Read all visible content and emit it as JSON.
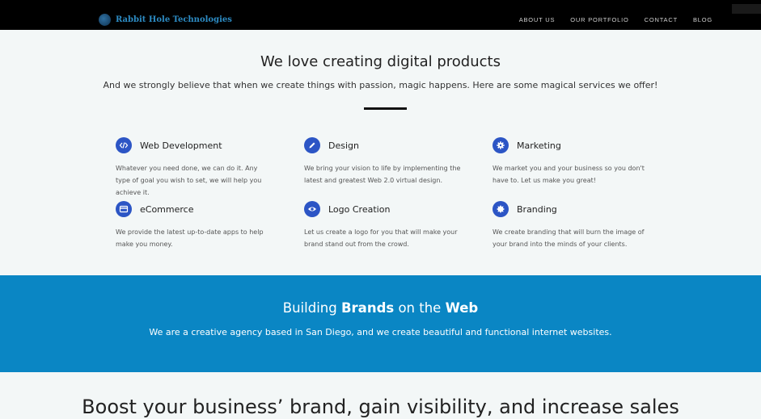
{
  "header": {
    "brand": "Rabbit Hole Technologies",
    "nav": [
      "ABOUT US",
      "OUR PORTFOLIO",
      "CONTACT",
      "BLOG"
    ]
  },
  "intro": {
    "title": "We love creating digital products",
    "subtitle": "And we strongly believe that when we create things with passion, magic happens. Here are some magical services we offer!"
  },
  "services": [
    {
      "title": "Web Development",
      "icon": "code-icon",
      "desc": "Whatever you need done, we can do it. Any type of goal you wish to set, we will help you achieve it."
    },
    {
      "title": "Design",
      "icon": "pencil-icon",
      "desc": "We bring your vision to life by implementing the latest and greatest Web 2.0 virtual design."
    },
    {
      "title": "Marketing",
      "icon": "gear-icon",
      "desc": "We market you and your business so you don't have to. Let us make you great!"
    },
    {
      "title": "eCommerce",
      "icon": "credit-card-icon",
      "desc": "We provide the latest up-to-date apps to help make you money."
    },
    {
      "title": "Logo Creation",
      "icon": "eye-icon",
      "desc": "Let us create a logo for you that will make your brand stand out from the crowd."
    },
    {
      "title": "Branding",
      "icon": "badge-icon",
      "desc": "We create branding that will burn the image of your brand into the minds of your clients."
    }
  ],
  "band": {
    "title_part1": "Building ",
    "title_bold1": "Brands",
    "title_part2": " on the ",
    "title_bold2": "Web",
    "subtitle": "We are a creative agency based in San Diego, and we create beautiful and functional internet websites."
  },
  "boost": {
    "title": "Boost your business’ brand, gain visibility, and increase sales"
  },
  "colors": {
    "accent": "#2c55c5",
    "band": "#0a86c4",
    "brand_text": "#2d8cc4"
  }
}
